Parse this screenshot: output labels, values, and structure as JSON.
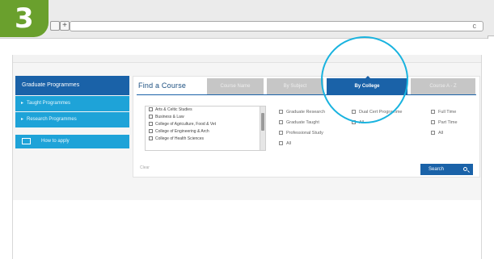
{
  "step": {
    "number": "3",
    "color": "#6aa02d"
  },
  "browser": {
    "new_tab": "+",
    "reload_glyph": "c"
  },
  "nav": {
    "heading": "Graduate Programmes",
    "items": [
      {
        "label": "Taught Programmes"
      },
      {
        "label": "Research Programmes"
      }
    ],
    "box_label": "How to apply"
  },
  "panel": {
    "title": "Find a Course",
    "tabs": [
      {
        "label": "Course Name",
        "active": false
      },
      {
        "label": "By Subject",
        "active": false
      },
      {
        "label": "By College",
        "active": true
      },
      {
        "label": "Course A - Z",
        "active": false
      }
    ],
    "colleges": [
      "Arts & Celtic Studies",
      "Business & Law",
      "College of Agriculture, Food & Vet",
      "College of Engineering & Arch",
      "College of Health Sciences"
    ],
    "study_options": [
      "Graduate Research",
      "Graduate Taught",
      "Professional Study",
      "All"
    ],
    "delivery_options": [
      "Dual Cert Programme",
      "All"
    ],
    "time_options": [
      "Full Time",
      "Part Time",
      "All"
    ],
    "clear_label": "Clear",
    "search_label": "Search"
  },
  "colors": {
    "primary": "#1a62a8",
    "secondary": "#1ea3d8",
    "highlight": "#19b3df"
  },
  "icons": [
    "plus-icon",
    "reload-icon",
    "checkbox-icon",
    "search-icon"
  ]
}
